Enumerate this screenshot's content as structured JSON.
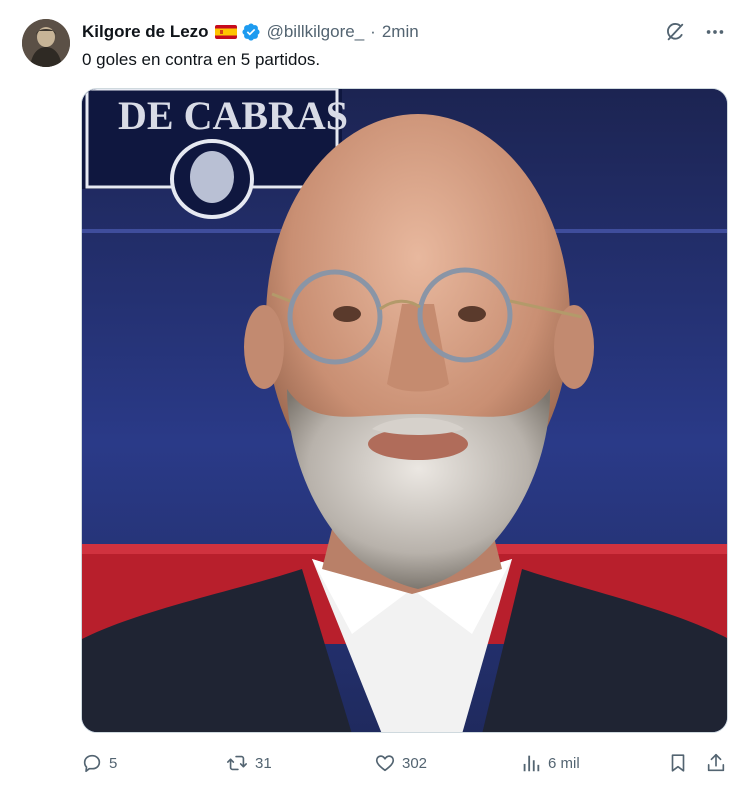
{
  "author": {
    "name": "Kilgore de Lezo",
    "handle": "@billkilgore_",
    "separator": "·",
    "time": "2min",
    "flag_icon": "spain-flag-icon",
    "verified_icon": "verified-badge-icon",
    "verified_color": "#1d9bf0"
  },
  "post": {
    "text": "0 goles en contra en 5 partidos.",
    "media_sign_text": "DE CABRAS"
  },
  "top_actions": {
    "grok_icon": "grok-icon",
    "more_icon": "more-dots-icon"
  },
  "actions": {
    "replies": "5",
    "reposts": "31",
    "likes": "302",
    "views": "6 mil"
  },
  "colors": {
    "text_primary": "#0f1419",
    "text_secondary": "#536471",
    "accent": "#1d9bf0"
  }
}
